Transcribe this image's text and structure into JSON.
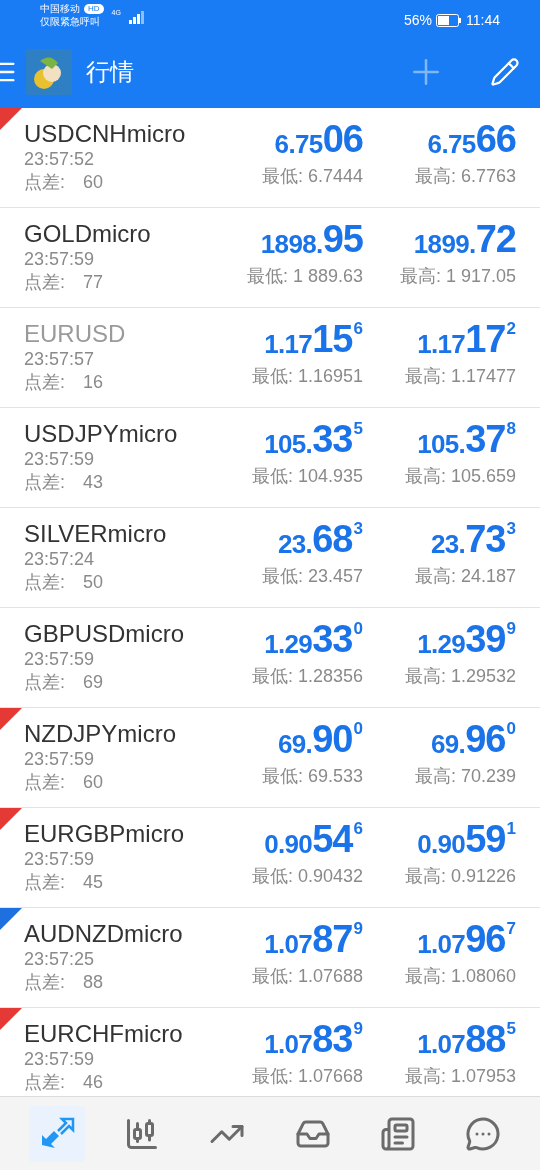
{
  "status_bar": {
    "carrier": "中国移动",
    "carrier_badge": "HD",
    "network": "4G",
    "notice": "仅限紧急呼叫",
    "battery": "56%",
    "time": "11:44"
  },
  "app_bar": {
    "title": "行情"
  },
  "quotes": [
    {
      "symbol": "USDCNHmicro",
      "dimmed": false,
      "time": "23:57:52",
      "spread_label": "点差:",
      "spread": "60",
      "bid": {
        "head": "6.75",
        "big": "06"
      },
      "ask": {
        "head": "6.75",
        "big": "66"
      },
      "low": "最低: 6.7444",
      "high": "最高: 6.7763",
      "color": "#e53935"
    },
    {
      "symbol": "GOLDmicro",
      "dimmed": false,
      "time": "23:57:59",
      "spread_label": "点差:",
      "spread": "77",
      "bid": {
        "head": "1898.",
        "big": "95"
      },
      "ask": {
        "head": "1899.",
        "big": "72"
      },
      "low": "最低: 1 889.63",
      "high": "最高: 1 917.05"
    },
    {
      "symbol": "EURUSD",
      "dimmed": true,
      "time": "23:57:57",
      "spread_label": "点差:",
      "spread": "16",
      "bid": {
        "head": "1.17",
        "big": "15",
        "tail": "6"
      },
      "ask": {
        "head": "1.17",
        "big": "17",
        "tail": "2"
      },
      "low": "最低: 1.16951",
      "high": "最高: 1.17477"
    },
    {
      "symbol": "USDJPYmicro",
      "dimmed": false,
      "time": "23:57:59",
      "spread_label": "点差:",
      "spread": "43",
      "bid": {
        "head": "105.",
        "big": "33",
        "tail": "5"
      },
      "ask": {
        "head": "105.",
        "big": "37",
        "tail": "8"
      },
      "low": "最低: 104.935",
      "high": "最高: 105.659"
    },
    {
      "symbol": "SILVERmicro",
      "dimmed": false,
      "time": "23:57:24",
      "spread_label": "点差:",
      "spread": "50",
      "bid": {
        "head": "23.",
        "big": "68",
        "tail": "3"
      },
      "ask": {
        "head": "23.",
        "big": "73",
        "tail": "3"
      },
      "low": "最低: 23.457",
      "high": "最高: 24.187"
    },
    {
      "symbol": "GBPUSDmicro",
      "dimmed": false,
      "time": "23:57:59",
      "spread_label": "点差:",
      "spread": "69",
      "bid": {
        "head": "1.29",
        "big": "33",
        "tail": "0"
      },
      "ask": {
        "head": "1.29",
        "big": "39",
        "tail": "9"
      },
      "low": "最低: 1.28356",
      "high": "最高: 1.29532"
    },
    {
      "symbol": "NZDJPYmicro",
      "dimmed": false,
      "time": "23:57:59",
      "spread_label": "点差:",
      "spread": "60",
      "bid": {
        "head": "69.",
        "big": "90",
        "tail": "0"
      },
      "ask": {
        "head": "69.",
        "big": "96",
        "tail": "0"
      },
      "low": "最低: 69.533",
      "high": "最高: 70.239",
      "color": "#e53935"
    },
    {
      "symbol": "EURGBPmicro",
      "dimmed": false,
      "time": "23:57:59",
      "spread_label": "点差:",
      "spread": "45",
      "bid": {
        "head": "0.90",
        "big": "54",
        "tail": "6"
      },
      "ask": {
        "head": "0.90",
        "big": "59",
        "tail": "1"
      },
      "low": "最低: 0.90432",
      "high": "最高: 0.91226",
      "color": "#e53935"
    },
    {
      "symbol": "AUDNZDmicro",
      "dimmed": false,
      "time": "23:57:25",
      "spread_label": "点差:",
      "spread": "88",
      "bid": {
        "head": "1.07",
        "big": "87",
        "tail": "9"
      },
      "ask": {
        "head": "1.07",
        "big": "96",
        "tail": "7"
      },
      "low": "最低: 1.07688",
      "high": "最高: 1.08060",
      "color": "#1e6fe0"
    },
    {
      "symbol": "EURCHFmicro",
      "dimmed": false,
      "time": "23:57:59",
      "spread_label": "点差:",
      "spread": "46",
      "bid": {
        "head": "1.07",
        "big": "83",
        "tail": "9"
      },
      "ask": {
        "head": "1.07",
        "big": "88",
        "tail": "5"
      },
      "low": "最低: 1.07668",
      "high": "最高: 1.07953",
      "color": "#e53935"
    }
  ],
  "bottom_nav": [
    {
      "kind": "quotes",
      "selected": true
    },
    {
      "kind": "chart",
      "selected": false
    },
    {
      "kind": "trade",
      "selected": false
    },
    {
      "kind": "history",
      "selected": false
    },
    {
      "kind": "news",
      "selected": false
    },
    {
      "kind": "messages",
      "selected": false
    }
  ]
}
